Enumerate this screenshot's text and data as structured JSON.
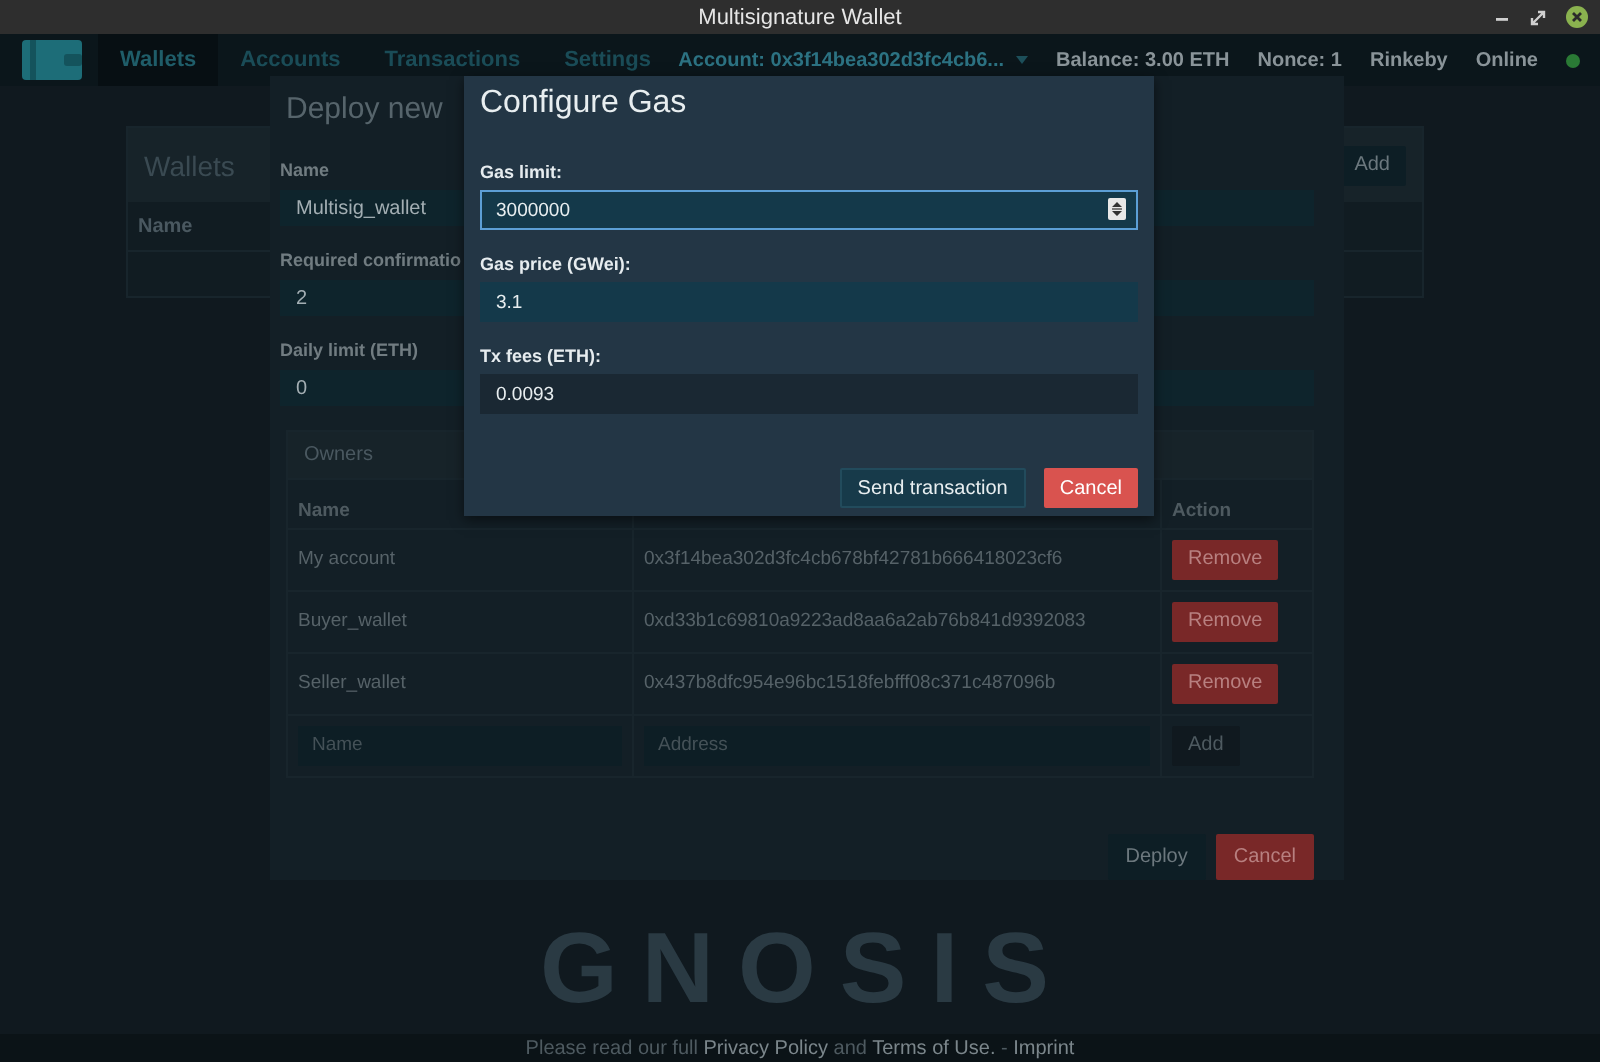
{
  "window": {
    "title": "Multisignature Wallet"
  },
  "navbar": {
    "tabs": [
      {
        "label": "Wallets",
        "selected": true
      },
      {
        "label": "Accounts",
        "selected": false
      },
      {
        "label": "Transactions",
        "selected": false
      },
      {
        "label": "Settings",
        "selected": false
      }
    ],
    "account": "Account: 0x3f14bea302d3fc4cb6...",
    "balance": "Balance: 3.00 ETH",
    "nonce": "Nonce: 1",
    "network": "Rinkeby",
    "status": {
      "label": "Online",
      "online": true
    }
  },
  "wallets_panel": {
    "title": "Wallets",
    "columns": [
      "Name"
    ],
    "add_button": "Add"
  },
  "deploy_dialog": {
    "title": "Deploy new",
    "fields": [
      {
        "label": "Name",
        "value": "Multisig_wallet"
      },
      {
        "label": "Required confirmatio",
        "value": "2"
      },
      {
        "label": "Daily limit (ETH)",
        "value": "0"
      }
    ],
    "owners": {
      "title": "Owners",
      "columns": [
        {
          "label": "Name",
          "kind": "name"
        },
        {
          "label": "Action",
          "kind": "action"
        }
      ],
      "rows": [
        {
          "name": "My account",
          "address": "0x3f14bea302d3fc4cb678bf42781b666418023cf6",
          "action": "Remove"
        },
        {
          "name": "Buyer_wallet",
          "address": "0xd33b1c69810a9223ad8aa6a2ab76b841d9392083",
          "action": "Remove"
        },
        {
          "name": "Seller_wallet",
          "address": "0x437b8dfc954e96bc1518febfff08c371c487096b",
          "action": "Remove"
        }
      ],
      "new_owner": {
        "name_placeholder": "Name",
        "address_placeholder": "Address",
        "button": "Add"
      }
    },
    "buttons": [
      {
        "label": "Deploy",
        "kind": "default"
      },
      {
        "label": "Cancel",
        "kind": "danger"
      }
    ]
  },
  "gas_dialog": {
    "title": "Configure Gas",
    "fields": [
      {
        "label": "Gas limit:",
        "value": "3000000",
        "kind": "number",
        "focused": true
      },
      {
        "label": "Gas price (GWei):",
        "value": "3.1",
        "kind": "text",
        "focused": false
      },
      {
        "label": "Tx fees (ETH):",
        "value": "0.0093",
        "kind": "readonly",
        "focused": false
      }
    ],
    "buttons": [
      {
        "label": "Send transaction",
        "kind": "default"
      },
      {
        "label": "Cancel",
        "kind": "danger"
      }
    ]
  },
  "background_logo": "GNOSIS",
  "footer": {
    "parts": [
      {
        "text": "Please read our full ",
        "link": false
      },
      {
        "text": "Privacy Policy",
        "link": true
      },
      {
        "text": " and ",
        "link": false
      },
      {
        "text": "Terms of Use.",
        "link": true
      },
      {
        "text": " - ",
        "link": false
      },
      {
        "text": "Imprint",
        "link": true
      }
    ]
  }
}
